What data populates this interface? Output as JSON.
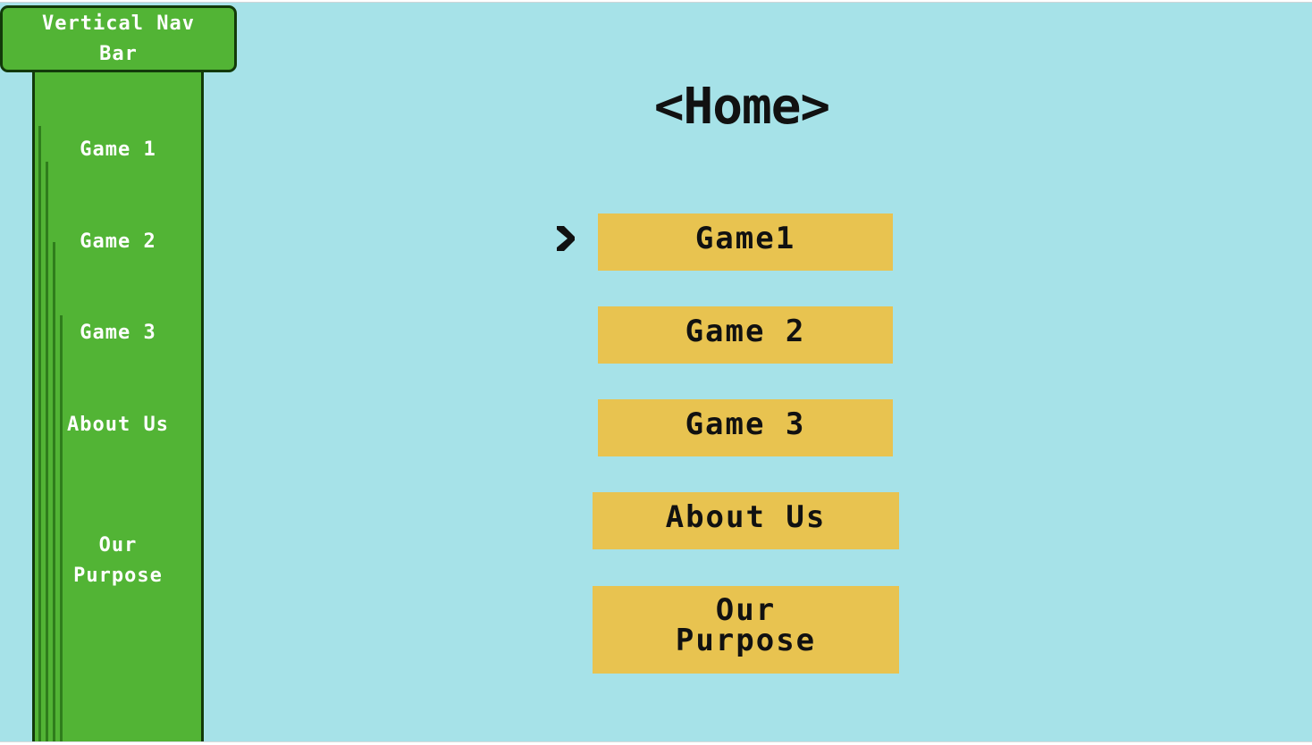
{
  "nav": {
    "title": "Vertical Nav Bar",
    "items": [
      {
        "label": "Game 1"
      },
      {
        "label": "Game 2"
      },
      {
        "label": "Game 3"
      },
      {
        "label": "About Us"
      },
      {
        "label": "Our Purpose"
      }
    ]
  },
  "main": {
    "title": "<Home>",
    "selector_icon": "chevron-right-icon",
    "buttons": [
      {
        "label": "Game1"
      },
      {
        "label": "Game 2"
      },
      {
        "label": "Game 3"
      },
      {
        "label": "About Us"
      },
      {
        "label": "Our Purpose"
      }
    ]
  },
  "colors": {
    "background": "#a6e2e8",
    "pipe_green": "#52b435",
    "pipe_outline": "#123a0a",
    "button_yellow": "#e8c350",
    "text_dark": "#111111",
    "nav_text": "#ffffff"
  }
}
